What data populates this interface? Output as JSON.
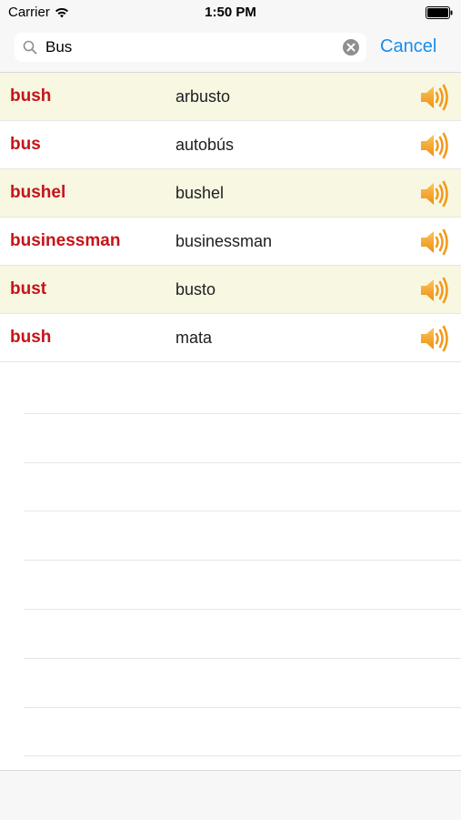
{
  "status_bar": {
    "carrier": "Carrier",
    "time": "1:50 PM"
  },
  "search": {
    "value": "Bus",
    "cancel_label": "Cancel"
  },
  "colors": {
    "accent": "#1a8cf0",
    "word": "#c5141a",
    "shaded_row": "#f7f7e2",
    "speaker": "#f5a623"
  },
  "results": [
    {
      "word": "bush",
      "translation": "arbusto"
    },
    {
      "word": "bus",
      "translation": "autobús"
    },
    {
      "word": "bushel",
      "translation": "bushel"
    },
    {
      "word": "businessman",
      "translation": "businessman"
    },
    {
      "word": "bust",
      "translation": "busto"
    },
    {
      "word": "bush",
      "translation": "mata"
    }
  ]
}
